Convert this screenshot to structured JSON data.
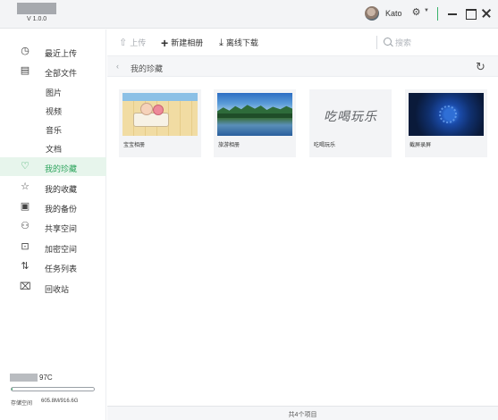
{
  "titlebar": {
    "version": "V 1.0.0",
    "username": "Kato",
    "settings_icon": "gear-icon",
    "accent_color": "#39b36b"
  },
  "sidebar": {
    "items": [
      {
        "label": "最近上传",
        "icon": "clock-icon",
        "glyph": "◷"
      },
      {
        "label": "全部文件",
        "icon": "file-icon",
        "glyph": "▤"
      },
      {
        "label": "图片"
      },
      {
        "label": "视频"
      },
      {
        "label": "音乐"
      },
      {
        "label": "文档"
      },
      {
        "label": "我的珍藏",
        "icon": "heart-icon",
        "glyph": "♡",
        "active": true
      },
      {
        "label": "我的收藏",
        "icon": "star-icon",
        "glyph": "☆"
      },
      {
        "label": "我的备份",
        "icon": "backup-icon",
        "glyph": "▣"
      },
      {
        "label": "共享空间",
        "icon": "users-icon",
        "glyph": "⚇"
      },
      {
        "label": "加密空间",
        "icon": "lock-icon",
        "glyph": "⊡"
      },
      {
        "label": "任务列表",
        "icon": "transfer-icon",
        "glyph": "⇅"
      },
      {
        "label": "回收站",
        "icon": "trash-icon",
        "glyph": "🗑"
      }
    ],
    "storage": {
      "device_suffix": "97C",
      "label": "存储空间",
      "value": "605.8M/916.6G",
      "used_fraction": 0.0006
    }
  },
  "toolbar": {
    "upload_label": "上传",
    "new_album_label": "新建相册",
    "offline_download_label": "离线下载",
    "search_placeholder": "搜索"
  },
  "breadcrumb": {
    "current": "我的珍藏"
  },
  "albums": [
    {
      "name": "宝宝相册"
    },
    {
      "name": "旅游相册"
    },
    {
      "name": "吃喝玩乐",
      "thumb_text": "吃喝玩乐"
    },
    {
      "name": "截屏录屏"
    }
  ],
  "status": {
    "text": "共4个项目"
  }
}
